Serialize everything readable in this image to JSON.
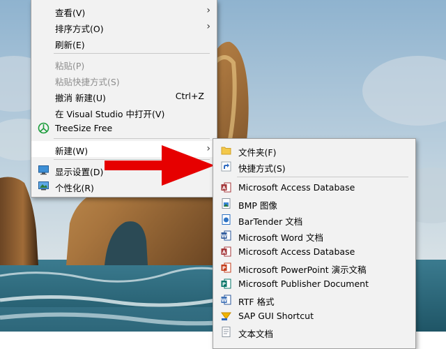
{
  "main_menu": {
    "items": [
      {
        "label": "查看(V)",
        "submenu": true
      },
      {
        "label": "排序方式(O)",
        "submenu": true
      },
      {
        "label": "刷新(E)"
      },
      {
        "label": "粘贴(P)",
        "disabled": true
      },
      {
        "label": "粘贴快捷方式(S)",
        "disabled": true
      },
      {
        "label": "撤消 新建(U)",
        "shortcut": "Ctrl+Z"
      },
      {
        "label": "在 Visual Studio 中打开(V)"
      },
      {
        "label": "TreeSize Free",
        "icon": "treesize-icon"
      },
      {
        "label": "新建(W)",
        "submenu": true
      },
      {
        "label": "显示设置(D)",
        "icon": "display-settings-icon"
      },
      {
        "label": "个性化(R)",
        "icon": "personalize-icon"
      }
    ],
    "submenu_arrow": "›"
  },
  "new_submenu": {
    "items": [
      {
        "label": "文件夹(F)",
        "icon": "folder-icon"
      },
      {
        "label": "快捷方式(S)",
        "icon": "shortcut-icon"
      },
      {
        "label": "Microsoft Access Database",
        "icon": "access-icon"
      },
      {
        "label": "BMP 图像",
        "icon": "bmp-icon"
      },
      {
        "label": "BarTender 文档",
        "icon": "bartender-icon"
      },
      {
        "label": "Microsoft Word 文档",
        "icon": "word-icon"
      },
      {
        "label": "Microsoft Access Database",
        "icon": "access-icon"
      },
      {
        "label": "Microsoft PowerPoint 演示文稿",
        "icon": "powerpoint-icon"
      },
      {
        "label": "Microsoft Publisher Document",
        "icon": "publisher-icon"
      },
      {
        "label": "RTF 格式",
        "icon": "rtf-icon"
      },
      {
        "label": "SAP GUI Shortcut",
        "icon": "sap-icon"
      },
      {
        "label": "文本文档",
        "icon": "text-document-icon"
      }
    ]
  },
  "colors": {
    "menu_bg": "#f2f2f2",
    "disabled_text": "#8d8d8d",
    "arrow_red": "#e60000",
    "sky": "#7fa8c8",
    "sea": "#2f6f86"
  }
}
